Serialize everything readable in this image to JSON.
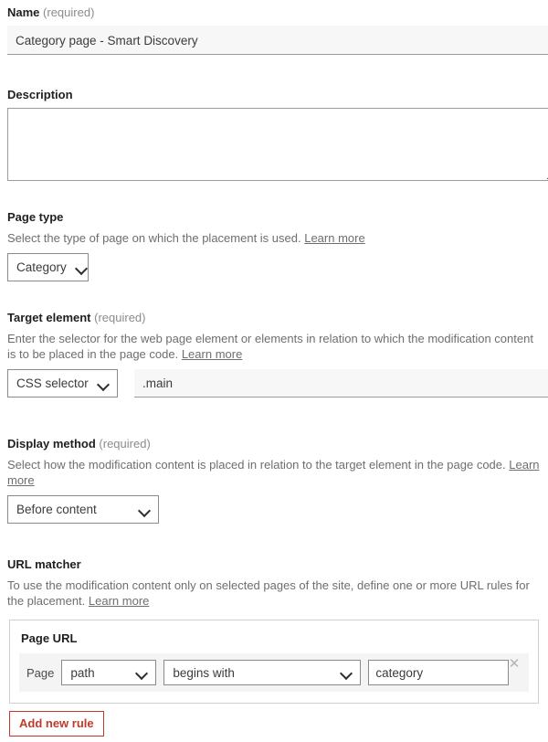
{
  "form": {
    "name": {
      "label": "Name",
      "required_note": "(required)",
      "value": "Category page - Smart Discovery"
    },
    "description": {
      "label": "Description",
      "value": "",
      "placeholder": ""
    },
    "page_type": {
      "label": "Page type",
      "helper": "Select the type of page on which the placement is used.",
      "learn_more": "Learn more",
      "selected": "Category"
    },
    "target_element": {
      "label": "Target element",
      "required_note": "(required)",
      "helper": "Enter the selector for the web page element or elements in relation to which the modification content is to be placed in the page code.",
      "learn_more": "Learn more",
      "selector_type": "CSS selector",
      "selector_value": ".main"
    },
    "display_method": {
      "label": "Display method",
      "required_note": "(required)",
      "helper": "Select how the modification content is placed in relation to the target element in the page code.",
      "learn_more": "Learn more",
      "selected": "Before content"
    },
    "url_matcher": {
      "label": "URL matcher",
      "helper": "To use the modification content only on selected pages of the site, define one or more URL rules for the placement.",
      "learn_more": "Learn more",
      "card_title": "Page URL",
      "rules": [
        {
          "prefix_label": "Page",
          "field": "path",
          "operator": "begins with",
          "value": "category",
          "remove_icon": "close-icon"
        }
      ],
      "add_button": "Add new rule"
    }
  },
  "icons": {
    "chevron_down": "chevron-down-icon",
    "close": "close-icon"
  },
  "colors": {
    "accent_red": "#c0392b",
    "text": "#333333",
    "muted": "#6e6e6e",
    "input_fill": "#f7f7f7",
    "card_border": "#d0d0d0",
    "rule_row_bg": "#f4f4f4"
  }
}
